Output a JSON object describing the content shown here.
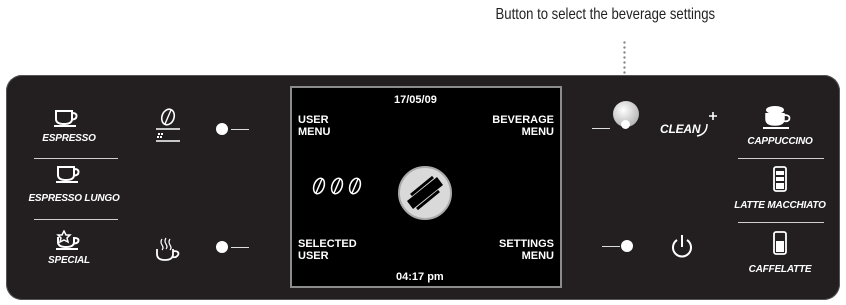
{
  "callout": {
    "text": "Button to select the beverage settings"
  },
  "left_column": {
    "espresso": "ESPRESSO",
    "espresso_lungo": "ESPRESSO LUNGO",
    "special": "SPECIAL"
  },
  "right_column": {
    "clean": "CLEAN",
    "cappuccino": "CAPPUCCINO",
    "latte_macchiato": "LATTE MACCHIATO",
    "caffelatte": "CAFFELATTE"
  },
  "display": {
    "date": "17/05/09",
    "time": "04:17 pm",
    "user_menu": [
      "USER",
      "MENU"
    ],
    "beverage_menu": [
      "BEVERAGE",
      "MENU"
    ],
    "selected_user": [
      "SELECTED",
      "USER"
    ],
    "settings_menu": [
      "SETTINGS",
      "MENU"
    ]
  },
  "colors": {
    "panel": "#231f20",
    "screen": "#000000",
    "text": "#ffffff"
  },
  "icons": [
    "cup-icon",
    "bean-icon",
    "hot-water-icon",
    "power-icon",
    "milk-glass-icon",
    "logo-icon"
  ]
}
